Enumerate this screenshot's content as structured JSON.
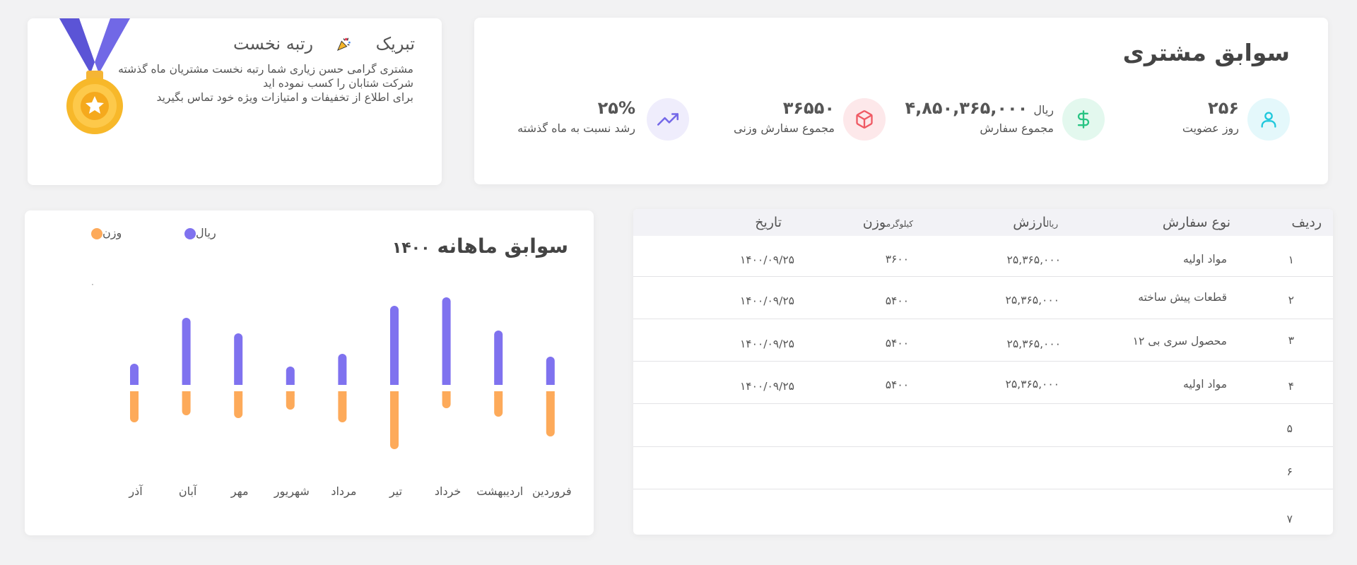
{
  "colors": {
    "accent_purple": "#7f72ef",
    "accent_orange": "#fdaa5a",
    "cyan": "#1fc8dc",
    "green": "#28c483",
    "red": "#ef5a64",
    "violet": "#7468e8"
  },
  "history": {
    "title": "سوابق مشتری",
    "stats": [
      {
        "icon": "user-icon",
        "value": "۲۵۶",
        "unit": "",
        "label": "روز عضویت"
      },
      {
        "icon": "dollar-icon",
        "value": "۴,۸۵۰,۳۶۵,۰۰۰",
        "unit": "ریال",
        "label": "مجموع سفارش"
      },
      {
        "icon": "box-icon",
        "value": "۳۶۵۵۰",
        "unit": "",
        "label": "مجموع سفارش وزنی"
      },
      {
        "icon": "trending-up-icon",
        "value": "۲۵%",
        "unit": "",
        "label": "رشد نسبت به ماه گذشته"
      }
    ]
  },
  "congrats": {
    "title_main": "رتبه نخست",
    "title_sub": "تبریک",
    "lines": [
      "مشتری گرامی حسن زیاری شما رتبه نخست مشتریان ماه گذشته",
      "شرکت شتابان را کسب نموده اید",
      "برای اطلاع از تخفیفات و امتیازات ویژه خود تماس بگیرید"
    ]
  },
  "orders": {
    "headers": {
      "row": "ردیف",
      "type": "نوع سفارش",
      "value": "ارزش",
      "value_unit": "ریال",
      "weight": "وزن",
      "weight_unit": "کیلوگرم",
      "date": "تاریخ"
    },
    "rows": [
      {
        "n": "۱",
        "type": "مواد اولیه",
        "value": "۲۵,۳۶۵,۰۰۰",
        "weight": "۳۶۰۰",
        "date": "۱۴۰۰/۰۹/۲۵"
      },
      {
        "n": "۲",
        "type": "قطعات پیش ساخته",
        "value": "۲۵,۳۶۵,۰۰۰",
        "weight": "۵۴۰۰",
        "date": "۱۴۰۰/۰۹/۲۵"
      },
      {
        "n": "۳",
        "type": "محصول سری بی ۱۲",
        "value": "۲۵,۳۶۵,۰۰۰",
        "weight": "۵۴۰۰",
        "date": "۱۴۰۰/۰۹/۲۵"
      },
      {
        "n": "۴",
        "type": "مواد اولیه",
        "value": "۲۵,۳۶۵,۰۰۰",
        "weight": "۵۴۰۰",
        "date": "۱۴۰۰/۰۹/۲۵"
      },
      {
        "n": "۵",
        "type": "",
        "value": "",
        "weight": "",
        "date": ""
      },
      {
        "n": "۶",
        "type": "",
        "value": "",
        "weight": "",
        "date": ""
      },
      {
        "n": "۷",
        "type": "",
        "value": "",
        "weight": "",
        "date": ""
      }
    ]
  },
  "monthly": {
    "title": "سوابق ماهانه",
    "year": "۱۴۰۰",
    "legend_rial": "ریال",
    "legend_weight": "وزن",
    "marker": "۰"
  },
  "chart_data": {
    "type": "bar",
    "categories": [
      "آذر",
      "آبان",
      "مهر",
      "شهریور",
      "مرداد",
      "تیر",
      "خرداد",
      "اردیبهشت",
      "فروردین"
    ],
    "series": [
      {
        "name": "ریال",
        "values": [
          30,
          95,
          73,
          26,
          44,
          112,
          124,
          77,
          40
        ]
      },
      {
        "name": "وزن",
        "values": [
          44,
          34,
          38,
          26,
          44,
          82,
          24,
          36,
          64
        ]
      }
    ],
    "note": "values estimated relative to baseline; no axis scale printed"
  }
}
